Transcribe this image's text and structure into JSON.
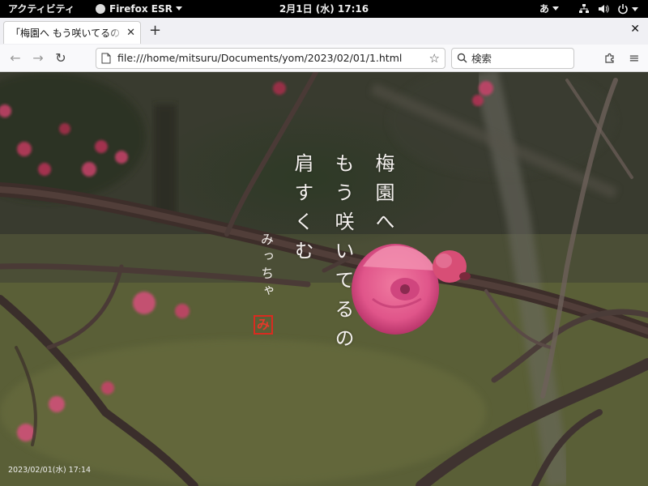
{
  "topbar": {
    "activities": "アクティビティ",
    "app_name": "Firefox ESR",
    "clock": "2月1日 (水)  17:16",
    "ime": "あ"
  },
  "browser": {
    "tab_title": "「梅園へ もう咲いてるの 肩すくむ」",
    "url": "file:///home/mitsuru/Documents/yom/2023/02/01/1.html",
    "search_placeholder": "検索"
  },
  "poem": {
    "line1": "梅園へ",
    "line2": "もう咲いてるの",
    "line3": "肩すくむ",
    "author": "みっちゃ",
    "seal": "み",
    "datetime": "2023/02/01(水) 17:14"
  }
}
